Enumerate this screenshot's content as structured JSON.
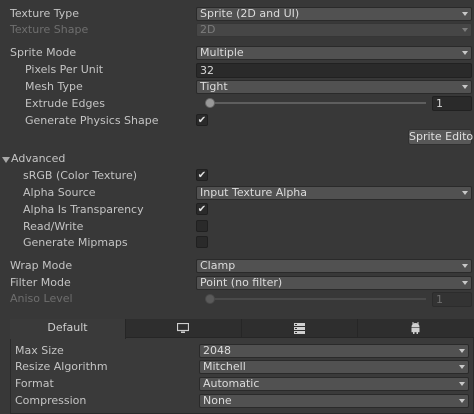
{
  "texture_type": {
    "label": "Texture Type",
    "value": "Sprite (2D and UI)"
  },
  "texture_shape": {
    "label": "Texture Shape",
    "value": "2D"
  },
  "sprite_mode": {
    "label": "Sprite Mode",
    "value": "Multiple"
  },
  "pixels_per_unit": {
    "label": "Pixels Per Unit",
    "value": "32"
  },
  "mesh_type": {
    "label": "Mesh Type",
    "value": "Tight"
  },
  "extrude_edges": {
    "label": "Extrude Edges",
    "value": "1",
    "slider_fraction": 0.02
  },
  "generate_physics_shape": {
    "label": "Generate Physics Shape",
    "checked": true,
    "mark": "✔"
  },
  "sprite_editor_button": "Sprite Editor",
  "advanced": {
    "label": "Advanced",
    "srgb": {
      "label": "sRGB (Color Texture)",
      "checked": true,
      "mark": "✔"
    },
    "alpha_source": {
      "label": "Alpha Source",
      "value": "Input Texture Alpha"
    },
    "alpha_is_transparency": {
      "label": "Alpha Is Transparency",
      "checked": true,
      "mark": "✔"
    },
    "read_write": {
      "label": "Read/Write",
      "checked": false
    },
    "generate_mipmaps": {
      "label": "Generate Mipmaps",
      "checked": false
    }
  },
  "wrap_mode": {
    "label": "Wrap Mode",
    "value": "Clamp"
  },
  "filter_mode": {
    "label": "Filter Mode",
    "value": "Point (no filter)"
  },
  "aniso_level": {
    "label": "Aniso Level",
    "value": "1",
    "slider_fraction": 0.02
  },
  "platform_tabs": [
    {
      "label": "Default",
      "icon": null,
      "active": true
    },
    {
      "label": "",
      "icon": "monitor-icon",
      "active": false
    },
    {
      "label": "",
      "icon": "server-icon",
      "active": false
    },
    {
      "label": "",
      "icon": "android-icon",
      "active": false
    }
  ],
  "platform_settings": {
    "max_size": {
      "label": "Max Size",
      "value": "2048"
    },
    "resize_algorithm": {
      "label": "Resize Algorithm",
      "value": "Mitchell"
    },
    "format": {
      "label": "Format",
      "value": "Automatic"
    },
    "compression": {
      "label": "Compression",
      "value": "None"
    }
  },
  "colors": {
    "background": "#383838",
    "field": "#2a2a2a",
    "dropdown": "#515151",
    "text": "#c4c4c4",
    "disabled_text": "#6e6e6e"
  }
}
